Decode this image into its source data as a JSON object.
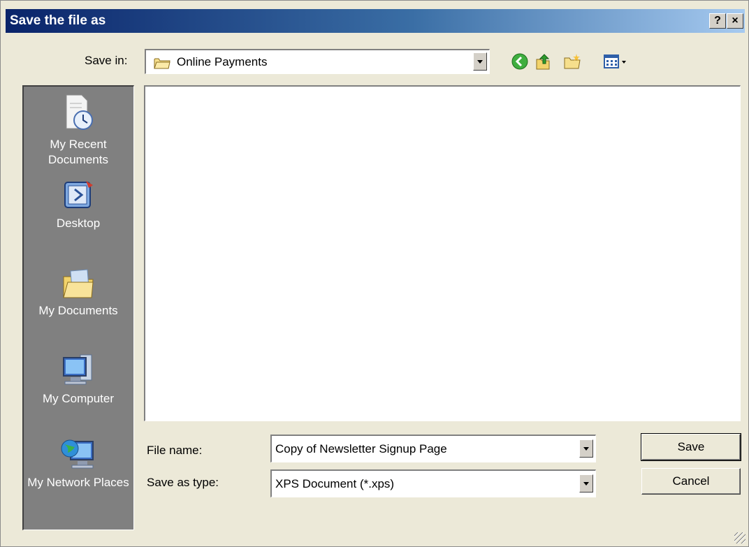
{
  "window": {
    "title": "Save the file as",
    "help_label": "?",
    "close_label": "×"
  },
  "save_in": {
    "label": "Save in:",
    "value": "Online Payments"
  },
  "toolbar": {
    "icons": [
      "back-icon",
      "up-folder-icon",
      "new-folder-icon",
      "views-menu-icon"
    ]
  },
  "places": [
    {
      "label": "My Recent Documents",
      "icon": "recent-documents-icon"
    },
    {
      "label": "Desktop",
      "icon": "desktop-icon"
    },
    {
      "label": "My Documents",
      "icon": "my-documents-icon"
    },
    {
      "label": "My Computer",
      "icon": "my-computer-icon"
    },
    {
      "label": "My Network Places",
      "icon": "network-places-icon"
    }
  ],
  "file_name": {
    "label": "File name:",
    "value": "Copy of Newsletter Signup Page"
  },
  "save_as_type": {
    "label": "Save as type:",
    "value": "XPS Document (*.xps)"
  },
  "buttons": {
    "save": "Save",
    "cancel": "Cancel"
  }
}
